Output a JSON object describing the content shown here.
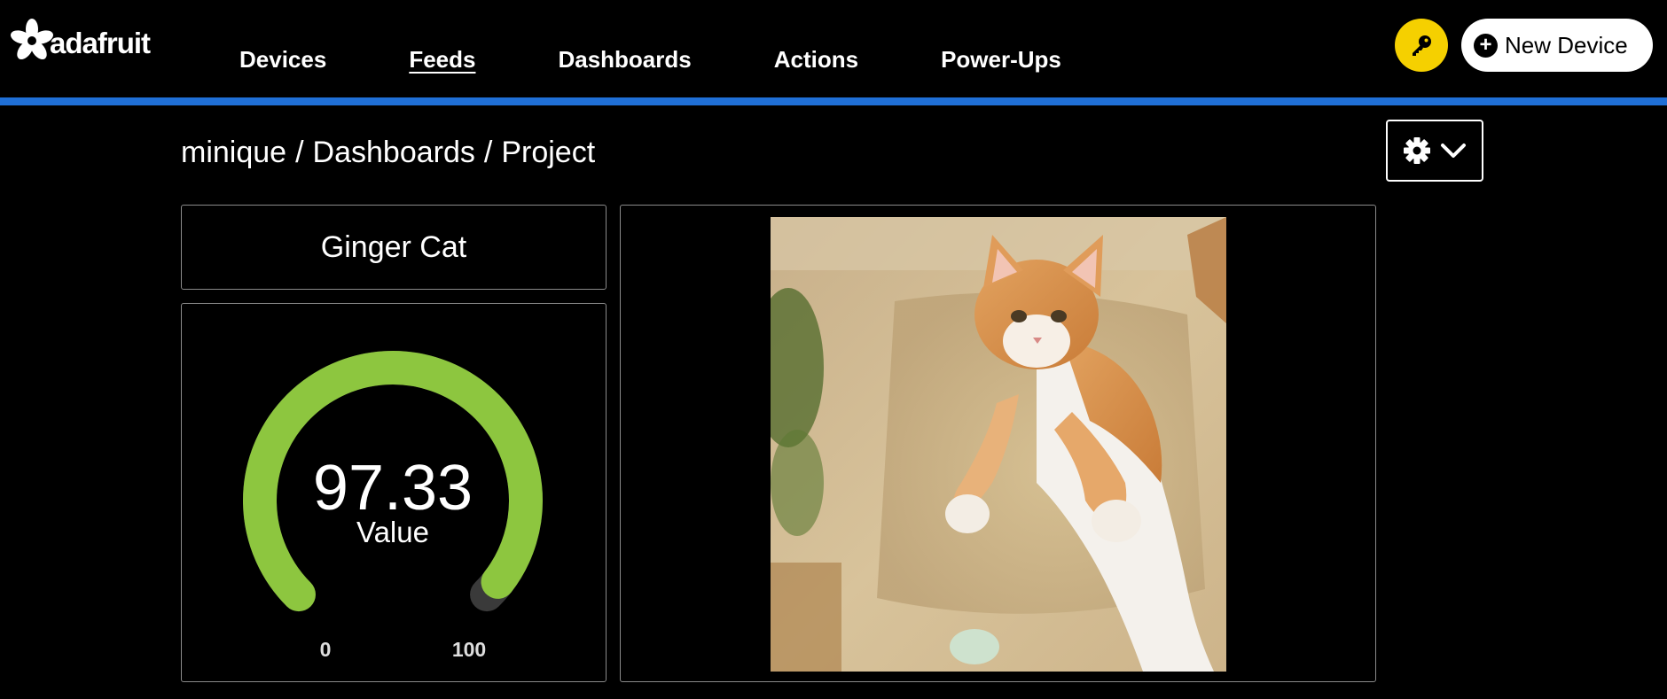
{
  "brand": {
    "logo_text": "adafruit"
  },
  "nav": {
    "items": [
      {
        "label": "Devices",
        "active": false
      },
      {
        "label": "Feeds",
        "active": true
      },
      {
        "label": "Dashboards",
        "active": false
      },
      {
        "label": "Actions",
        "active": false
      },
      {
        "label": "Power-Ups",
        "active": false
      }
    ]
  },
  "header": {
    "key_icon": "key-icon",
    "new_device_label": "New Device",
    "accent_color": "#1f6fd6",
    "key_button_color": "#f5d000"
  },
  "breadcrumb": {
    "user": "minique",
    "sep1": "/",
    "section": "Dashboards",
    "sep2": "/",
    "page": "Project"
  },
  "settings": {
    "icons": [
      "gear-icon",
      "chevron-down-icon"
    ]
  },
  "blocks": {
    "text_block": {
      "title": "Ginger Cat"
    },
    "gauge": {
      "value": "97.33",
      "label": "Value",
      "min": "0",
      "max": "100",
      "fraction": 0.9733,
      "fill_color": "#8dc63f",
      "track_color": "#3a3a3a"
    },
    "image": {
      "subject": "ginger kitten leaping"
    }
  }
}
